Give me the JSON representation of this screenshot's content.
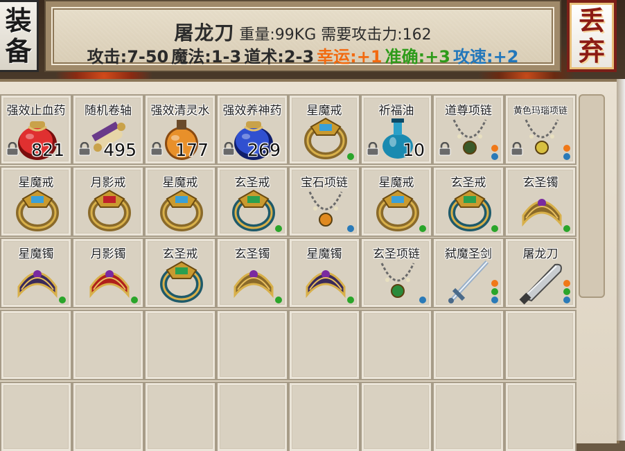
{
  "header": {
    "equip_button": [
      "装",
      "备"
    ],
    "discard_button": [
      "丢",
      "弃"
    ],
    "item_name": "屠龙刀",
    "weight": "重量:99KG",
    "requirement": "需要攻击力:162",
    "stats": [
      {
        "text": "攻击:7-50",
        "color": "#2a2a2a"
      },
      {
        "text": "魔法:1-3",
        "color": "#2a2a2a"
      },
      {
        "text": "道术:2-3",
        "color": "#2a2a2a"
      },
      {
        "text": "幸运:+1",
        "color": "#f26a10"
      },
      {
        "text": "准确:+3",
        "color": "#2e9b1a"
      },
      {
        "text": "攻速:+2",
        "color": "#2277bb"
      }
    ]
  },
  "dot_colors": {
    "orange": "#f07818",
    "green": "#2aa52a",
    "blue": "#2a7ab8"
  },
  "inventory": {
    "rows": 5,
    "cols": 8,
    "items": [
      {
        "name": "强效止血药",
        "icon": "red-potion-bag-icon",
        "qty": "821",
        "locked": true,
        "dots": []
      },
      {
        "name": "随机卷轴",
        "icon": "scroll-icon",
        "qty": "495",
        "locked": true,
        "dots": []
      },
      {
        "name": "强效清灵水",
        "icon": "orange-potion-flask-icon",
        "qty": "177",
        "locked": true,
        "dots": []
      },
      {
        "name": "强效养神药",
        "icon": "blue-potion-bag-icon",
        "qty": "269",
        "locked": true,
        "dots": []
      },
      {
        "name": "星魔戒",
        "icon": "star-demon-ring-icon",
        "qty": "",
        "locked": false,
        "dots": [
          "green"
        ]
      },
      {
        "name": "祈福油",
        "icon": "blessing-oil-bottle-icon",
        "qty": "10",
        "locked": true,
        "dots": []
      },
      {
        "name": "道尊项链",
        "icon": "dao-necklace-icon",
        "qty": "",
        "locked": true,
        "dots": [
          "orange",
          "blue"
        ]
      },
      {
        "name": "黄色玛瑙项链",
        "icon": "agate-necklace-icon",
        "qty": "",
        "locked": true,
        "dots": [
          "orange",
          "blue"
        ]
      },
      {
        "name": "星魔戒",
        "icon": "star-demon-ring-icon",
        "qty": "",
        "locked": false,
        "dots": []
      },
      {
        "name": "月影戒",
        "icon": "moon-shadow-ring-icon",
        "qty": "",
        "locked": false,
        "dots": []
      },
      {
        "name": "星魔戒",
        "icon": "star-demon-ring-icon",
        "qty": "",
        "locked": false,
        "dots": []
      },
      {
        "name": "玄圣戒",
        "icon": "xuansheng-ring-icon",
        "qty": "",
        "locked": false,
        "dots": [
          "green"
        ]
      },
      {
        "name": "宝石项链",
        "icon": "gem-necklace-icon",
        "qty": "",
        "locked": false,
        "dots": [
          "blue"
        ]
      },
      {
        "name": "星魔戒",
        "icon": "star-demon-ring-icon",
        "qty": "",
        "locked": false,
        "dots": [
          "green"
        ]
      },
      {
        "name": "玄圣戒",
        "icon": "xuansheng-ring-icon",
        "qty": "",
        "locked": false,
        "dots": [
          "green"
        ]
      },
      {
        "name": "玄圣镯",
        "icon": "xuansheng-bracelet-icon",
        "qty": "",
        "locked": false,
        "dots": [
          "green"
        ]
      },
      {
        "name": "星魔镯",
        "icon": "star-demon-bracelet-icon",
        "qty": "",
        "locked": false,
        "dots": [
          "green"
        ]
      },
      {
        "name": "月影镯",
        "icon": "moon-shadow-bracelet-icon",
        "qty": "",
        "locked": false,
        "dots": [
          "green"
        ]
      },
      {
        "name": "玄圣戒",
        "icon": "xuansheng-ring-icon",
        "qty": "",
        "locked": false,
        "dots": []
      },
      {
        "name": "玄圣镯",
        "icon": "xuansheng-bracelet-icon",
        "qty": "",
        "locked": false,
        "dots": [
          "green"
        ]
      },
      {
        "name": "星魔镯",
        "icon": "star-demon-bracelet-icon",
        "qty": "",
        "locked": false,
        "dots": [
          "green"
        ]
      },
      {
        "name": "玄圣项链",
        "icon": "xuansheng-necklace-icon",
        "qty": "",
        "locked": false,
        "dots": [
          "blue"
        ]
      },
      {
        "name": "弑魔圣剑",
        "icon": "demon-slayer-sword-icon",
        "qty": "",
        "locked": false,
        "dots": [
          "orange",
          "green",
          "blue"
        ]
      },
      {
        "name": "屠龙刀",
        "icon": "dragon-slayer-blade-icon",
        "qty": "",
        "locked": false,
        "dots": [
          "orange",
          "green",
          "blue"
        ]
      }
    ]
  }
}
